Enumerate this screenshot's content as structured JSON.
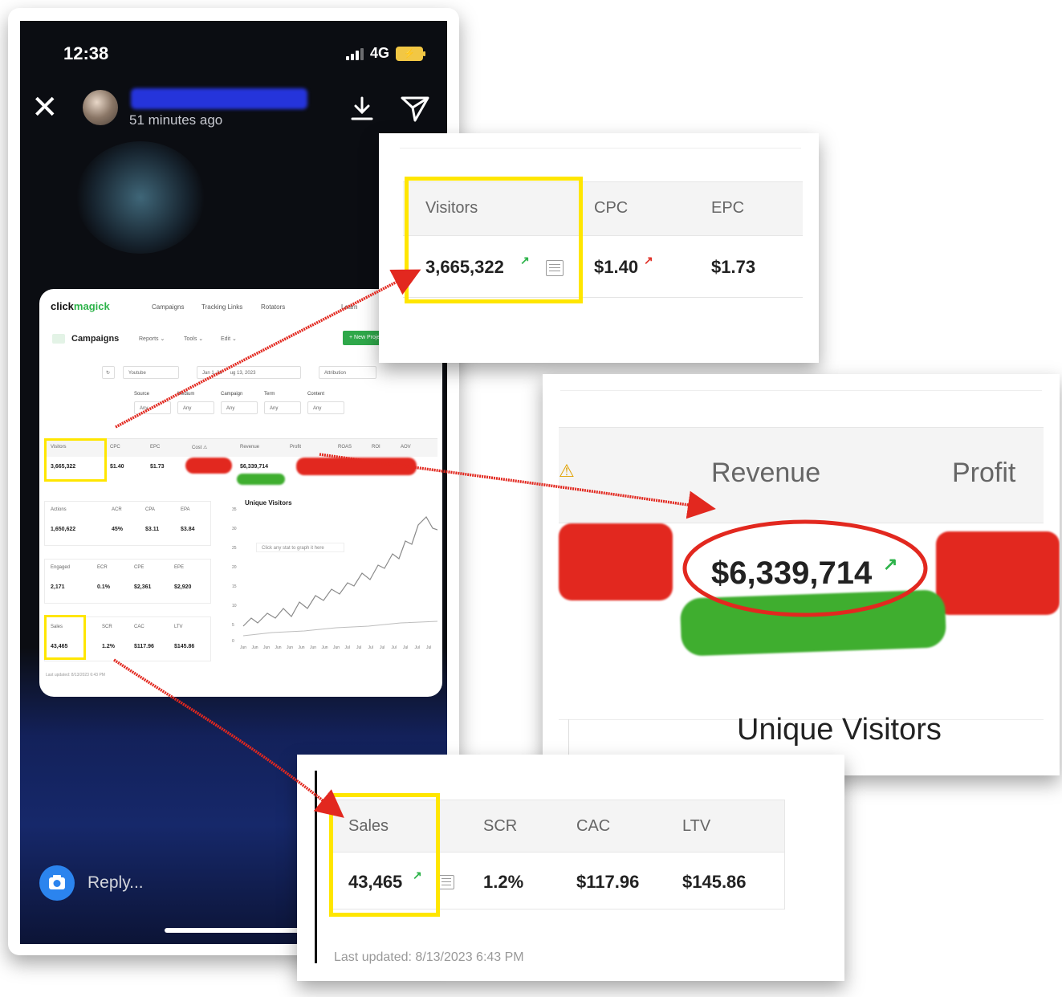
{
  "phone": {
    "time": "12:38",
    "network": "4G",
    "story_time": "51 minutes ago",
    "reply_placeholder": "Reply..."
  },
  "dashboard": {
    "logo_a": "click",
    "logo_b": "magick",
    "nav": [
      "Campaigns",
      "Tracking Links",
      "Rotators",
      "Learn"
    ],
    "page_title": "Campaigns",
    "submenu": [
      "Reports ⌄",
      "Tools ⌄",
      "Edit ⌄"
    ],
    "new_project": "+ New Proje",
    "filter_source": "Youtube",
    "filter_dates": "Jan 1, 20",
    "filter_dates_end": "ug 13, 2023",
    "filter_attr": "Attribution",
    "filter_labels": [
      "Source",
      "Medium",
      "Campaign",
      "Term",
      "Content"
    ],
    "filter_any": "Any",
    "row1_headers": [
      "Visitors",
      "CPC",
      "EPC",
      "Cost ⚠",
      "Revenue",
      "Profit",
      "ROAS",
      "ROI",
      "AOV"
    ],
    "row1_values": [
      "3,665,322",
      "$1.40",
      "$1.73",
      "$6,339,714"
    ],
    "row2_headers": [
      "Actions",
      "ACR",
      "CPA",
      "EPA"
    ],
    "row2_values": [
      "1,650,622",
      "45%",
      "$3.11",
      "$3.84"
    ],
    "row3_headers": [
      "Engaged",
      "ECR",
      "CPE",
      "EPE"
    ],
    "row3_values": [
      "2,171",
      "0.1%",
      "$2,361",
      "$2,920"
    ],
    "row4_headers": [
      "Sales",
      "SCR",
      "CAC",
      "LTV"
    ],
    "row4_values": [
      "43,465",
      "1.2%",
      "$117.96",
      "$145.86"
    ],
    "chart_title": "Unique Visitors",
    "chart_hint": "Click any stat to graph it here",
    "y_ticks": [
      "35",
      "30",
      "25",
      "20",
      "15",
      "10",
      "5",
      "0"
    ],
    "x_ticks": [
      "Jun 1",
      "Jun 3",
      "Jun 5",
      "Jun 9",
      "Jun 13",
      "Jun 17",
      "Jun 21",
      "Jun 25",
      "Jun 29",
      "Jul 3",
      "Jul 7",
      "Jul 11",
      "Jul 15",
      "Jul 19",
      "Jul 23",
      "Jul 27",
      "Jul 31"
    ],
    "last_updated": "Last updated: 8/13/2023 6:43 PM"
  },
  "zoom_visitors": {
    "headers": [
      "Visitors",
      "CPC",
      "EPC"
    ],
    "values": [
      "3,665,322",
      "$1.40",
      "$1.73"
    ]
  },
  "zoom_revenue": {
    "headers": [
      "Revenue",
      "Profit"
    ],
    "value": "$6,339,714",
    "chart_title": "Unique Visitors"
  },
  "zoom_sales": {
    "headers": [
      "Sales",
      "SCR",
      "CAC",
      "LTV"
    ],
    "values": [
      "43,465",
      "1.2%",
      "$117.96",
      "$145.86"
    ],
    "last_updated": "Last updated: 8/13/2023 6:43 PM"
  },
  "colors": {
    "highlight_yellow": "#ffe600",
    "annotation_red": "#e2281f",
    "brand_green": "#2fa84a",
    "trend_up_green": "#2db34a",
    "trend_up_red": "#e0332a"
  }
}
